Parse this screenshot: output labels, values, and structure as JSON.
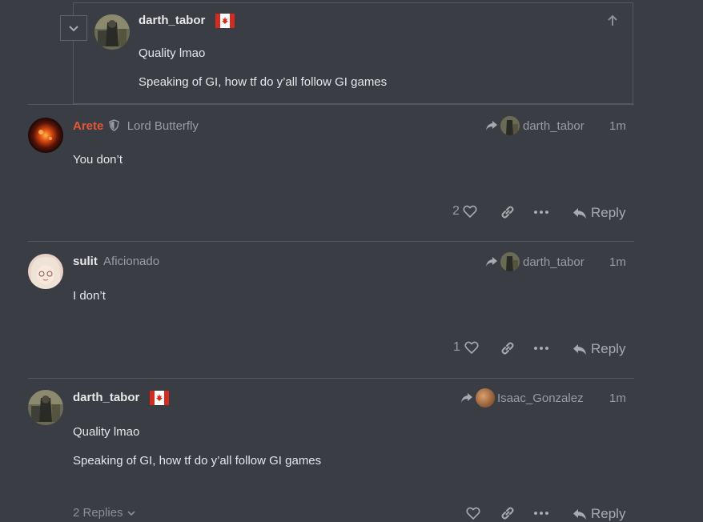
{
  "embedded_post": {
    "username": "darth_tabor",
    "lines": [
      "Quality lmao",
      "Speaking of GI, how tf do y’all follow GI games"
    ]
  },
  "posts": [
    {
      "username": "Arete",
      "user_title": "Lord Butterfly",
      "reply_to": "darth_tabor",
      "time": "1m",
      "lines": [
        "You don’t"
      ],
      "like_count": "2",
      "reply_label": "Reply"
    },
    {
      "username": "sulit",
      "user_title": "Aficionado",
      "reply_to": "darth_tabor",
      "time": "1m",
      "lines": [
        "I don’t"
      ],
      "like_count": "1",
      "reply_label": "Reply"
    },
    {
      "username": "darth_tabor",
      "user_title": "",
      "reply_to": "Isaac_Gonzalez",
      "time": "1m",
      "lines": [
        "Quality lmao",
        "Speaking of GI, how tf do y’all follow GI games"
      ],
      "like_count": "",
      "reply_label": "Reply",
      "replies_label": "2 Replies"
    }
  ],
  "colors": {
    "background": "#3a3d44",
    "staff_name": "#e45735",
    "muted": "#9a9ca2",
    "canada_red": "#d52b1e"
  }
}
